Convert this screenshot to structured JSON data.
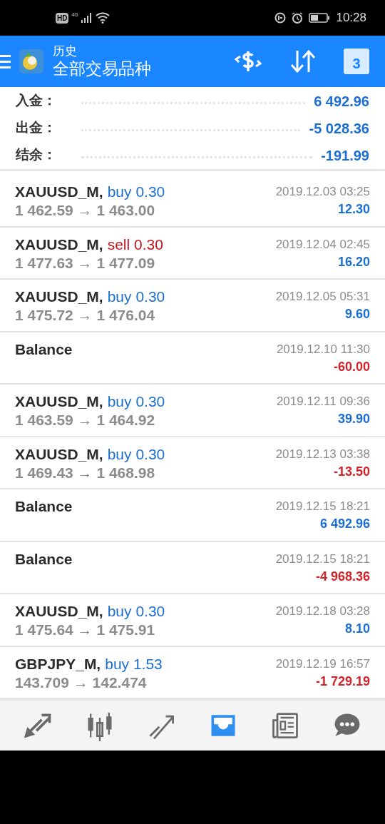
{
  "status_bar": {
    "network": "HD",
    "signal_type": "4G",
    "time": "10:28"
  },
  "header": {
    "title": "历史",
    "subtitle": "全部交易品种",
    "calendar_day": "3"
  },
  "summary": [
    {
      "label": "入金：",
      "value": "6 492.96"
    },
    {
      "label": "出金：",
      "value": "-5 028.36"
    },
    {
      "label": "结余：",
      "value": "-191.99"
    }
  ],
  "rows": [
    {
      "kind": "buy",
      "symbol": "XAUUSD_M,",
      "action": "buy 0.30",
      "prices": "1 462.59 → 1 463.00",
      "time": "2019.12.03 03:25",
      "profit": "12.30",
      "loss": false
    },
    {
      "kind": "sell",
      "symbol": "XAUUSD_M,",
      "action": "sell 0.30",
      "prices": "1 477.63 → 1 477.09",
      "time": "2019.12.04 02:45",
      "profit": "16.20",
      "loss": false
    },
    {
      "kind": "buy",
      "symbol": "XAUUSD_M,",
      "action": "buy 0.30",
      "prices": "1 475.72 → 1 476.04",
      "time": "2019.12.05 05:31",
      "profit": "9.60",
      "loss": false
    },
    {
      "kind": "balance",
      "symbol": "Balance",
      "time": "2019.12.10 11:30",
      "profit": "-60.00",
      "loss": true
    },
    {
      "kind": "buy",
      "symbol": "XAUUSD_M,",
      "action": "buy 0.30",
      "prices": "1 463.59 → 1 464.92",
      "time": "2019.12.11 09:36",
      "profit": "39.90",
      "loss": false
    },
    {
      "kind": "buy",
      "symbol": "XAUUSD_M,",
      "action": "buy 0.30",
      "prices": "1 469.43 → 1 468.98",
      "time": "2019.12.13 03:38",
      "profit": "-13.50",
      "loss": true
    },
    {
      "kind": "balance",
      "symbol": "Balance",
      "time": "2019.12.15 18:21",
      "profit": "6 492.96",
      "loss": false
    },
    {
      "kind": "balance",
      "symbol": "Balance",
      "time": "2019.12.15 18:21",
      "profit": "-4 968.36",
      "loss": true
    },
    {
      "kind": "buy",
      "symbol": "XAUUSD_M,",
      "action": "buy 0.30",
      "prices": "1 475.64 → 1 475.91",
      "time": "2019.12.18 03:28",
      "profit": "8.10",
      "loss": false
    },
    {
      "kind": "buy",
      "symbol": "GBPJPY_M,",
      "action": "buy 1.53",
      "prices": "143.709 → 142.474",
      "time": "2019.12.19 16:57",
      "profit": "-1 729.19",
      "loss": true
    }
  ],
  "bottom_nav": [
    {
      "selected": false
    },
    {
      "selected": false
    },
    {
      "selected": false
    },
    {
      "selected": true
    },
    {
      "selected": false
    },
    {
      "selected": false
    }
  ]
}
